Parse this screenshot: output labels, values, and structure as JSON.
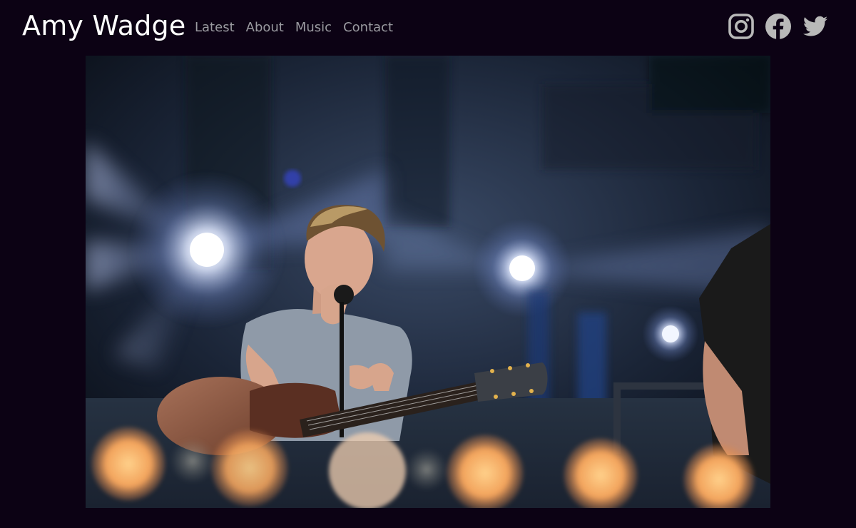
{
  "site": {
    "title": "Amy Wadge"
  },
  "nav": {
    "items": [
      {
        "label": "Latest"
      },
      {
        "label": "About"
      },
      {
        "label": "Music"
      },
      {
        "label": "Contact"
      }
    ]
  },
  "social": {
    "icons": [
      "instagram-icon",
      "facebook-icon",
      "twitter-icon"
    ],
    "color": "#b9b9b9"
  },
  "hero": {
    "description": "photo"
  },
  "colors": {
    "background": "#0c0214",
    "title": "#ffffff",
    "nav": "#9a9aa0"
  }
}
